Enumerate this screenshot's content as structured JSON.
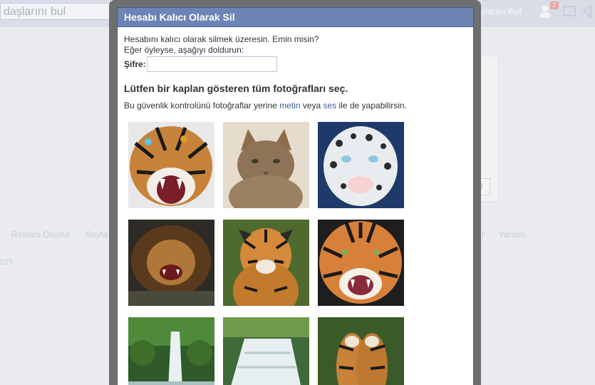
{
  "background": {
    "search_text": "daşlarını bul",
    "find_friends": "şlarını Bul",
    "friend_request_count": "2",
    "save_label": "al",
    "footer_links": [
      "Reklam Oluştur",
      "Sayfa",
      "r",
      "Yardım"
    ],
    "copyright": "015"
  },
  "dialog": {
    "title": "Hesabı Kalıcı Olarak Sil",
    "line1": "Hesabını kalıcı olarak silmek üzeresin. Emin misin?",
    "line2": "Eğer öyleyse, aşağıyı doldurun:",
    "password_label": "Şifre:",
    "password_value": "",
    "instruction": "Lütfen bir kaplan gösteren tüm fotoğrafları seç.",
    "alt_prefix": "Bu güvenlik kontrolünü fotoğraflar yerine ",
    "alt_link_text": "metin",
    "alt_middle": " veya ",
    "alt_link_audio": "ses",
    "alt_suffix": " ile de yapabilirsin."
  },
  "photos": [
    {
      "subject": "tiger-roaring"
    },
    {
      "subject": "cat"
    },
    {
      "subject": "snow-leopard"
    },
    {
      "subject": "lion-roaring"
    },
    {
      "subject": "tiger-in-grass"
    },
    {
      "subject": "tiger-face-snarl"
    },
    {
      "subject": "waterfall-forest"
    },
    {
      "subject": "waterfall-cascade"
    },
    {
      "subject": "two-tigers"
    }
  ],
  "colors": {
    "header_bg": "#6d84b4",
    "border": "#3b5998",
    "link": "#3b5998"
  }
}
